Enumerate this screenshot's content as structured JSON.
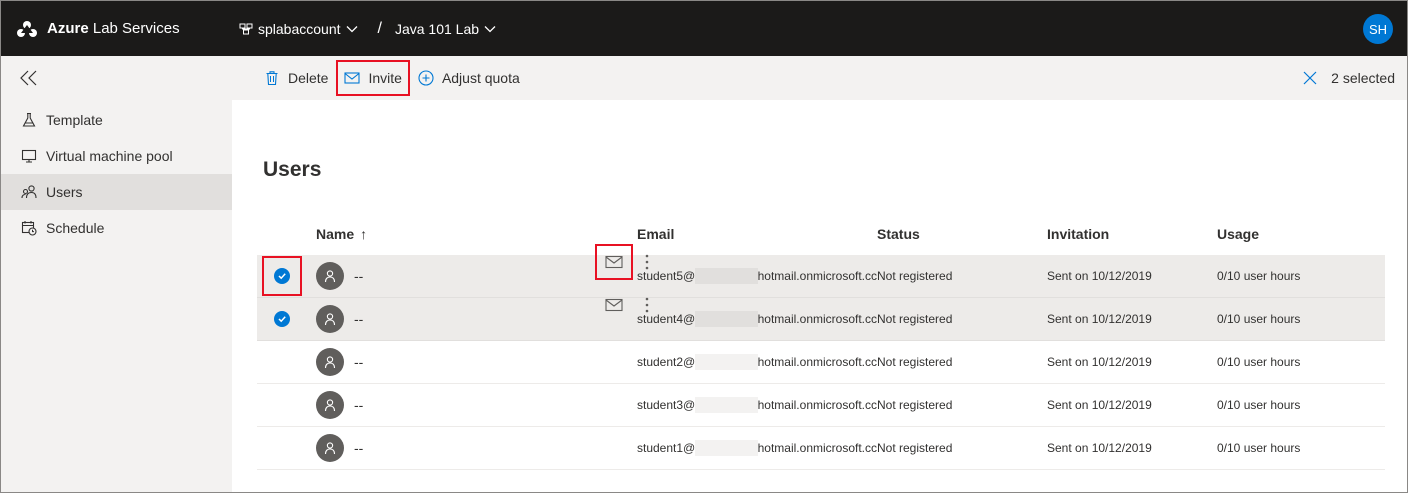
{
  "app": {
    "title_bold": "Azure",
    "title_rest": " Lab Services"
  },
  "breadcrumb": {
    "account": "splabaccount",
    "separator": "/",
    "lab": "Java 101 Lab"
  },
  "user": {
    "initials": "SH"
  },
  "sidebar": {
    "items": [
      {
        "label": "Template",
        "icon": "flask-icon"
      },
      {
        "label": "Virtual machine pool",
        "icon": "monitor-icon"
      },
      {
        "label": "Users",
        "icon": "users-icon",
        "active": true
      },
      {
        "label": "Schedule",
        "icon": "calendar-icon"
      }
    ]
  },
  "toolbar": {
    "delete_label": "Delete",
    "invite_label": "Invite",
    "adjust_quota_label": "Adjust quota",
    "selected_label": "2 selected"
  },
  "page": {
    "title": "Users"
  },
  "table": {
    "columns": {
      "name": "Name",
      "sort_indicator": "↑",
      "email": "Email",
      "status": "Status",
      "invitation": "Invitation",
      "usage": "Usage"
    },
    "rows": [
      {
        "selected": true,
        "name": "--",
        "email_prefix": "student5@",
        "email_suffix": "hotmail.onmicrosoft.cc",
        "status": "Not registered",
        "invitation": "Sent on 10/12/2019",
        "usage": "0/10 user hours"
      },
      {
        "selected": true,
        "name": "--",
        "email_prefix": "student4@",
        "email_suffix": "hotmail.onmicrosoft.cc",
        "status": "Not registered",
        "invitation": "Sent on 10/12/2019",
        "usage": "0/10 user hours"
      },
      {
        "selected": false,
        "name": "--",
        "email_prefix": "student2@",
        "email_suffix": "hotmail.onmicrosoft.cc",
        "status": "Not registered",
        "invitation": "Sent on 10/12/2019",
        "usage": "0/10 user hours"
      },
      {
        "selected": false,
        "name": "--",
        "email_prefix": "student3@",
        "email_suffix": "hotmail.onmicrosoft.cc",
        "status": "Not registered",
        "invitation": "Sent on 10/12/2019",
        "usage": "0/10 user hours"
      },
      {
        "selected": false,
        "name": "--",
        "email_prefix": "student1@",
        "email_suffix": "hotmail.onmicrosoft.cc",
        "status": "Not registered",
        "invitation": "Sent on 10/12/2019",
        "usage": "0/10 user hours"
      }
    ]
  },
  "colors": {
    "accent": "#0078d4",
    "topbar": "#1b1a19",
    "highlight": "#e81123",
    "avatar": "#605e5c"
  }
}
